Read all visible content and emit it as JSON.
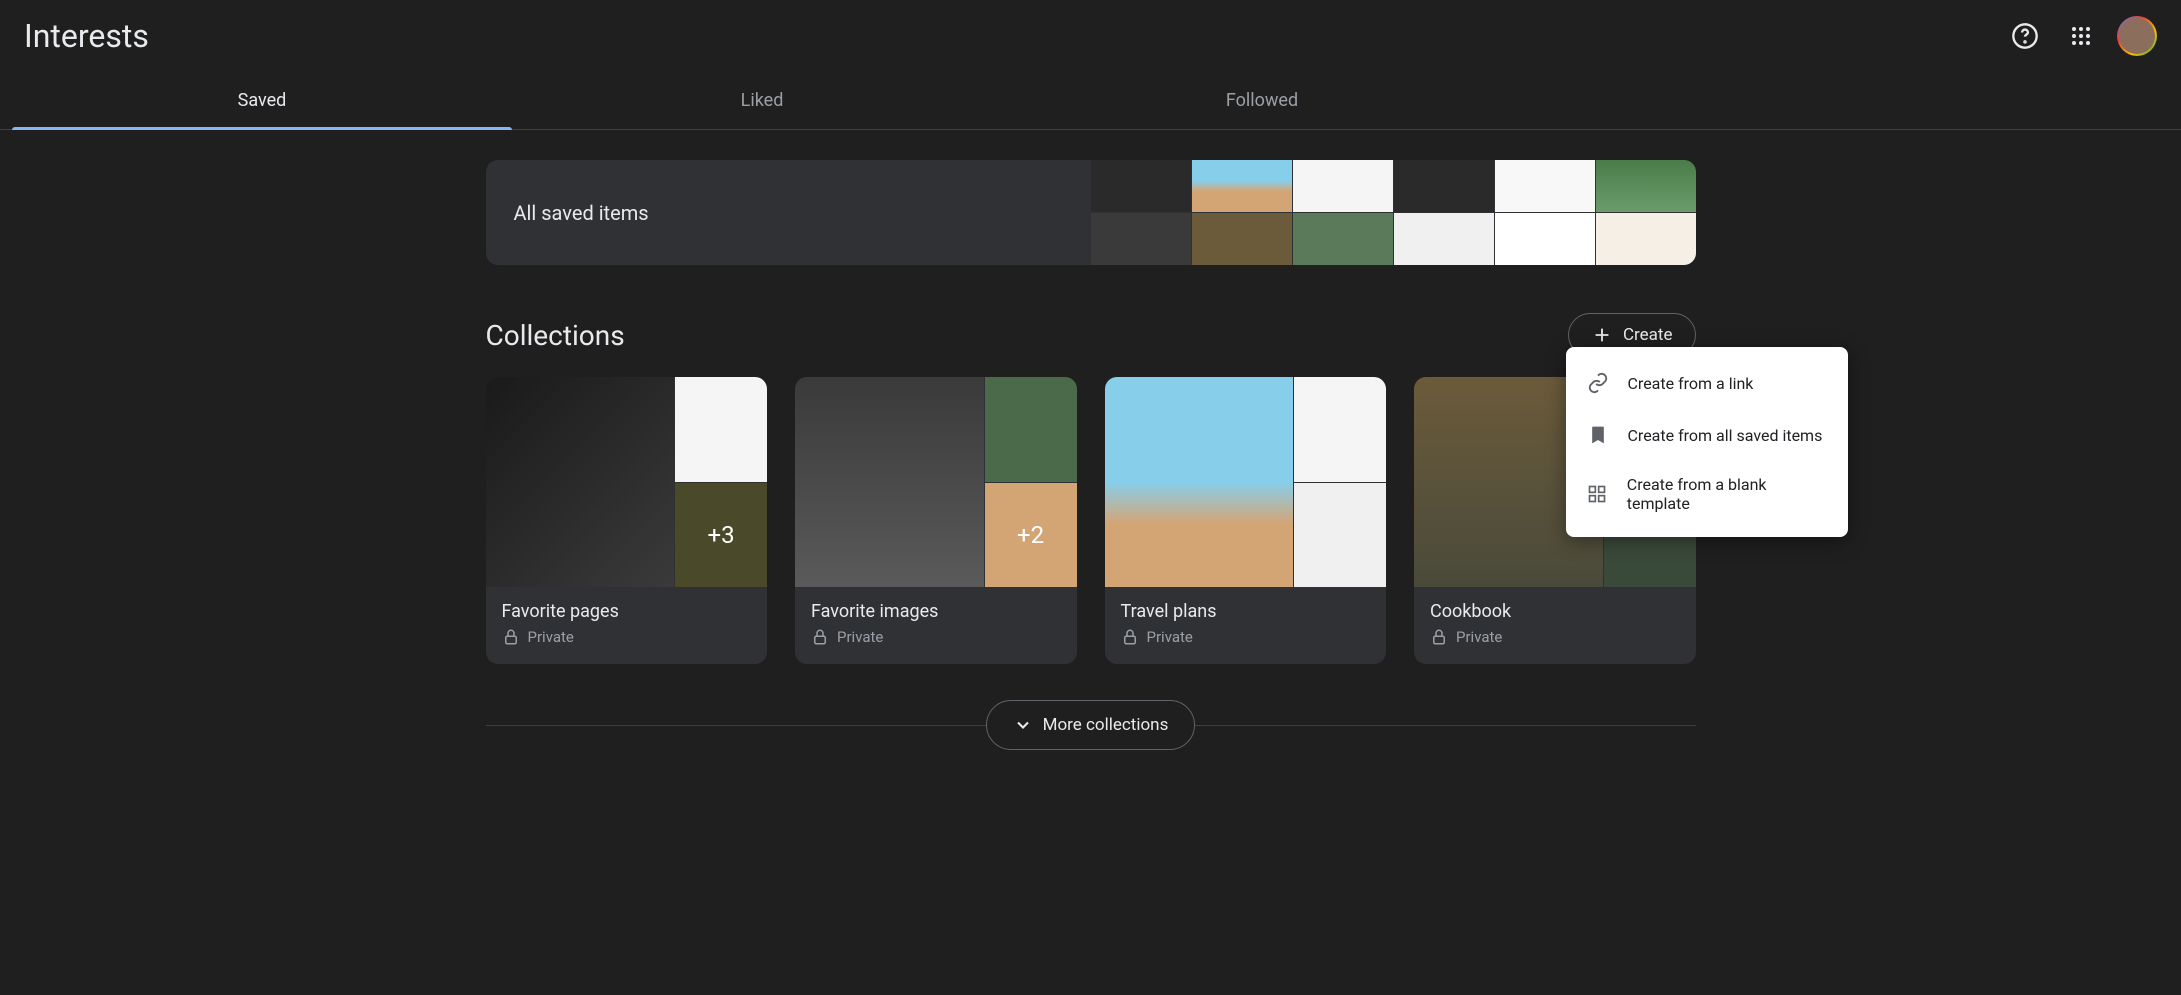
{
  "header": {
    "title": "Interests"
  },
  "tabs": [
    "Saved",
    "Liked",
    "Followed"
  ],
  "allSaved": {
    "label": "All saved items"
  },
  "sections": {
    "collections": "Collections"
  },
  "createButton": "Create",
  "createMenu": [
    "Create from a link",
    "Create from all saved items",
    "Create from a blank template"
  ],
  "collections": [
    {
      "title": "Favorite pages",
      "privacy": "Private",
      "overflow": "+3"
    },
    {
      "title": "Favorite images",
      "privacy": "Private",
      "overflow": "+2"
    },
    {
      "title": "Travel plans",
      "privacy": "Private",
      "overflow": ""
    },
    {
      "title": "Cookbook",
      "privacy": "Private",
      "overflow": ""
    }
  ],
  "moreButton": "More collections"
}
